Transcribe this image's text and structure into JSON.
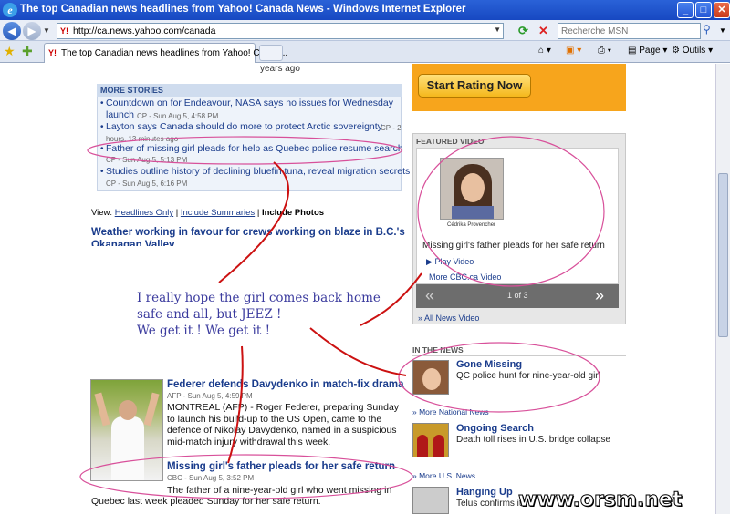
{
  "window": {
    "title": "The top Canadian news headlines from Yahoo! Canada News - Windows Internet Explorer",
    "min": "_",
    "max": "□",
    "close": "✕"
  },
  "addressbar": {
    "url": "http://ca.news.yahoo.com/canada",
    "search_placeholder": "Recherche MSN"
  },
  "tabs": {
    "active_label": "The top Canadian news headlines from Yahoo! Canad...",
    "page_menu": "Page",
    "tools_menu": "Outils"
  },
  "content": {
    "clipped_top": "years ago",
    "more_stories": {
      "heading": "MORE STORIES",
      "items": [
        {
          "title": "Countdown on for Endeavour, NASA says no issues for Wednesday",
          "title_cont": "launch",
          "meta": "CP - Sun Aug 5, 4:58 PM"
        },
        {
          "title": "Layton says Canada should do more to protect Arctic sovereignty",
          "meta_inline": "CP - 2",
          "meta": "hours, 13 minutes ago"
        },
        {
          "title": "Father of missing girl pleads for help as Quebec police resume search",
          "meta": "CP - Sun Aug 5, 5:13 PM"
        },
        {
          "title": "Studies outline history of declining bluefin tuna, reveal migration secrets",
          "meta": "CP - Sun Aug 5, 6:16 PM"
        }
      ]
    },
    "view": {
      "label": "View:",
      "headlines_only": "Headlines Only",
      "sep1": "|",
      "include_summaries": "Include Summaries",
      "sep2": "|",
      "include_photos": "Include Photos"
    },
    "weather_headline": "Weather working in favour for crews working on blaze in B.C.'s",
    "weather_headline_cont": "Okanagan Valley",
    "handwritten_note": [
      "I really hope the girl comes back home",
      "safe and all, but JEEZ !",
      "We get it ! We get it !"
    ],
    "federer": {
      "headline": "Federer defends Davydenko in match-fix drama",
      "meta": "AFP - Sun Aug 5, 4:59 PM",
      "text": "MONTREAL (AFP) - Roger Federer, preparing Sunday to launch his build-up to the US Open, came to the defence of Nikolay Davydenko, named in a suspicious mid-match injury withdrawal this week."
    },
    "missing": {
      "headline": "Missing girl's father pleads for her safe return",
      "meta": "CBC - Sun Aug 5, 3:52 PM",
      "text": "The father of a nine-year-old girl who went missing in Quebec last week pleaded Sunday for her safe return."
    }
  },
  "sidebar": {
    "rate_button": "Start Rating Now",
    "featured_video": {
      "heading": "FEATURED VIDEO",
      "photo_caption": "Cédrika Provencher",
      "caption": "Missing girl's father pleads for her safe return",
      "play": "Play Video",
      "more": "More CBC.ca Video",
      "counter": "1 of 3",
      "prev": "«",
      "next": "»",
      "all_news_video": "» All News Video"
    },
    "in_the_news": {
      "heading": "IN THE NEWS",
      "items": [
        {
          "title": "Gone Missing",
          "text": "QC police hunt for nine-year-old girl"
        },
        {
          "title": "Ongoing Search",
          "text": "Death toll rises in U.S. bridge collapse"
        },
        {
          "title": "Hanging Up",
          "text": "Telus confirms it"
        }
      ],
      "more_national": "» More National News",
      "more_us": "» More U.S. News"
    }
  },
  "watermark": "www.orsm.net",
  "colors": {
    "link": "#1a3c8c",
    "annotation_red": "#cc1111",
    "annotation_pink": "#d8509a",
    "handwriting": "#3b3b9e"
  }
}
